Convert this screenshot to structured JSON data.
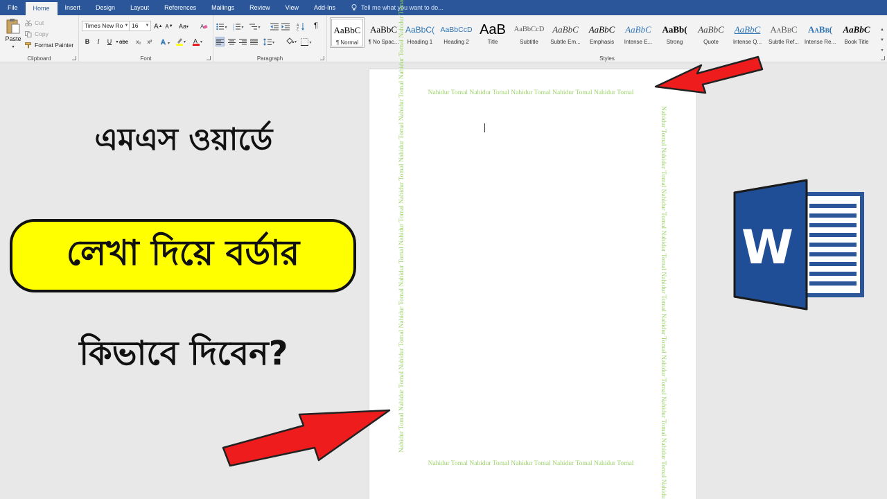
{
  "tabs": [
    {
      "label": "File",
      "active": false
    },
    {
      "label": "Home",
      "active": true
    },
    {
      "label": "Insert",
      "active": false
    },
    {
      "label": "Design",
      "active": false
    },
    {
      "label": "Layout",
      "active": false
    },
    {
      "label": "References",
      "active": false
    },
    {
      "label": "Mailings",
      "active": false
    },
    {
      "label": "Review",
      "active": false
    },
    {
      "label": "View",
      "active": false
    },
    {
      "label": "Add-Ins",
      "active": false
    }
  ],
  "tell_me": "Tell me what you want to do...",
  "clipboard": {
    "paste": "Paste",
    "cut": "Cut",
    "copy": "Copy",
    "format_painter": "Format Painter",
    "label": "Clipboard"
  },
  "font": {
    "name": "Times New Ro",
    "size": "16",
    "grow": "A",
    "shrink": "A",
    "change_case": "Aa",
    "bold": "B",
    "italic": "I",
    "underline": "U",
    "strike": "abc",
    "subscript": "x₂",
    "superscript": "x²",
    "label": "Font"
  },
  "paragraph": {
    "label": "Paragraph",
    "show_marks": "¶"
  },
  "styles": {
    "label": "Styles",
    "items": [
      {
        "preview": "AaBbC",
        "name": "¶ Normal",
        "color": "#000000",
        "italic": false,
        "active": true
      },
      {
        "preview": "AaBbC",
        "name": "¶ No Spac...",
        "color": "#000000",
        "italic": false,
        "active": false
      },
      {
        "preview": "AaBbC(",
        "name": "Heading 1",
        "color": "#2e74b5",
        "italic": false,
        "active": false
      },
      {
        "preview": "AaBbCcD",
        "name": "Heading 2",
        "color": "#2e74b5",
        "italic": false,
        "active": false
      },
      {
        "preview": "AaB",
        "name": "Title",
        "color": "#000000",
        "italic": false,
        "active": false
      },
      {
        "preview": "AaBbCcD",
        "name": "Subtitle",
        "color": "#595959",
        "italic": false,
        "active": false
      },
      {
        "preview": "AaBbC",
        "name": "Subtle Em...",
        "color": "#404040",
        "italic": true,
        "active": false
      },
      {
        "preview": "AaBbC",
        "name": "Emphasis",
        "color": "#000000",
        "italic": true,
        "active": false
      },
      {
        "preview": "AaBbC",
        "name": "Intense E...",
        "color": "#2e74b5",
        "italic": true,
        "active": false
      },
      {
        "preview": "AaBb(",
        "name": "Strong",
        "color": "#000000",
        "italic": false,
        "active": false
      },
      {
        "preview": "AaBbC",
        "name": "Quote",
        "color": "#404040",
        "italic": true,
        "active": false
      },
      {
        "preview": "AaBbC",
        "name": "Intense Q...",
        "color": "#2e74b5",
        "italic": true,
        "active": false
      },
      {
        "preview": "AaBbC",
        "name": "Subtle Ref...",
        "color": "#595959",
        "italic": false,
        "active": false
      },
      {
        "preview": "AaBb(",
        "name": "Intense Re...",
        "color": "#2e74b5",
        "italic": false,
        "active": false
      },
      {
        "preview": "AaBbC",
        "name": "Book Title",
        "color": "#000000",
        "italic": true,
        "active": false
      }
    ]
  },
  "document": {
    "border_top": "Nahidur Tomal Nahidur Tomal Nahidur Tomal Nahidur Tomal Nahidur Tomal",
    "border_bottom": "Nahidur Tomal Nahidur Tomal Nahidur Tomal Nahidur Tomal Nahidur Tomal",
    "border_left": "Nahidur Tomal Nahidur Tomal Nahidur Tomal Nahidur Tomal Nahidur Tomal Nahidur Tomal Nahidur Tomal Nahidur Tomal Nahidur Tomal Nahidur Tomal Nahidur Tomal",
    "border_right": "Nahidur Tomal Nahidur Tomal Nahidur Tomal Nahidur Tomal Nahidur Tomal Nahidur Tomal Nahidur Tomal Nahidur Tomal Nahidur Tomal Nahidur Tomal Nahidur Tomal",
    "border_color": "#9bd36a"
  },
  "overlay": {
    "line1": "এমএস ওয়ার্ডে",
    "line2": "লেখা দিয়ে বর্ডার",
    "line3": "কিভাবে দিবেন?",
    "highlight_color": "#ffff00",
    "arrow_color": "#ee1c1c"
  },
  "word_logo_letter": "W"
}
